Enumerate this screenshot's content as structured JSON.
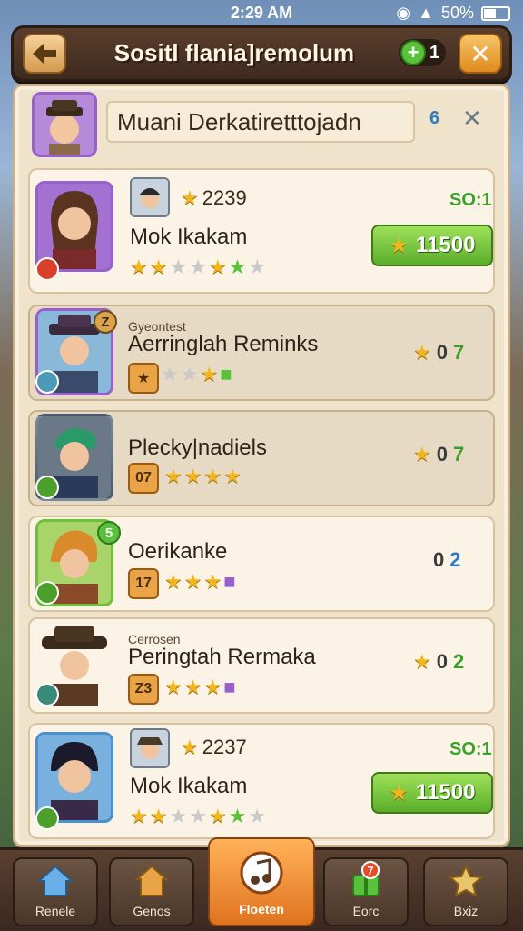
{
  "status": {
    "time": "2:29 AM",
    "battery": "50%"
  },
  "header": {
    "title": "Sositl flania]remolum",
    "plus_count": "1",
    "plus_symbol": "+",
    "close_symbol": "✕"
  },
  "profile": {
    "name": "Muani Derkatiretttojadn",
    "count": "6",
    "x_symbol": "✕"
  },
  "rows": [
    {
      "name": "Mok Ikakam",
      "score": "2239",
      "tag": "SO:1",
      "button": "11500",
      "rank_badge": ""
    },
    {
      "title": "Gyeontest",
      "name": "Aerringlah Reminks",
      "stat_a": "0",
      "stat_b": "7",
      "rank_badge": "Z"
    },
    {
      "name": "Plecky|nadiels",
      "level": "07",
      "stat_a": "0",
      "stat_b": "7"
    },
    {
      "name": "Oerikanke",
      "level": "17",
      "stat_a": "0",
      "stat_b": "2",
      "rank_badge": "5"
    },
    {
      "title": "Cerrosen",
      "name": "Peringtah Rermaka",
      "level": "Z3",
      "stat_a": "0",
      "stat_b": "2"
    },
    {
      "name": "Mok Ikakam",
      "score": "2237",
      "tag": "SO:1",
      "button": "11500"
    }
  ],
  "nav": [
    {
      "label": "Renele"
    },
    {
      "label": "Genos"
    },
    {
      "label": "Floeten"
    },
    {
      "label": "Eorc",
      "badge": "7"
    },
    {
      "label": "Bxiz"
    }
  ],
  "colors": {
    "accent": "#e0731e",
    "green": "#5aae2a",
    "panel": "#efe3cc"
  }
}
